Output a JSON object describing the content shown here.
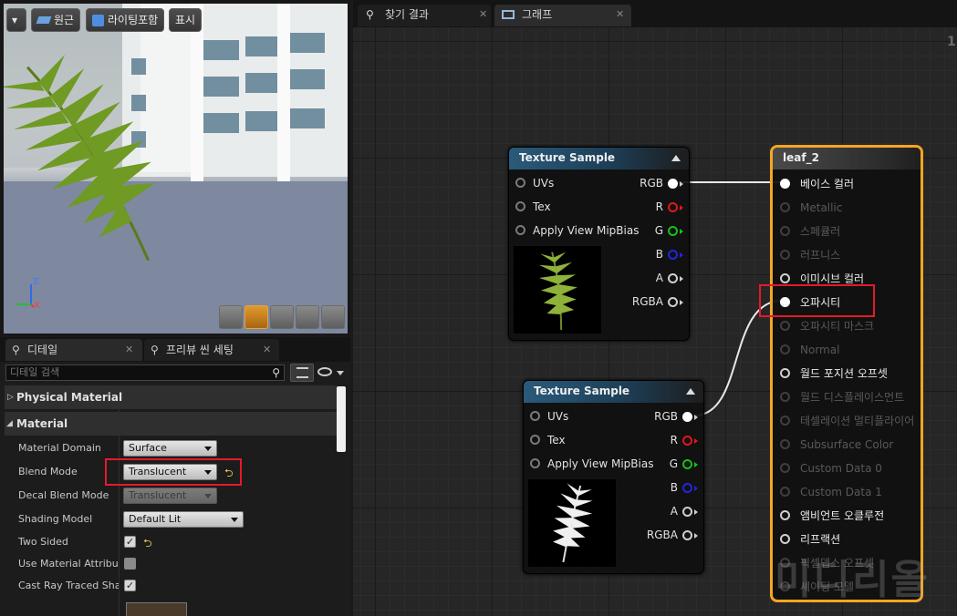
{
  "viewport": {
    "menu_label": "▾",
    "perspective_label": "원근",
    "lit_label": "라이팅포함",
    "show_label": "표시",
    "axis_z": "Z",
    "axis_x": "X"
  },
  "details": {
    "tab1": "디테일",
    "tab2": "프리뷰 씬 세팅",
    "search_placeholder": "디테일 검색",
    "section_physical": "Physical Material",
    "section_material": "Material",
    "props": [
      {
        "label": "Material Domain",
        "value": "Surface"
      },
      {
        "label": "Blend Mode",
        "value": "Translucent"
      },
      {
        "label": "Decal Blend Mode",
        "value": "Translucent"
      },
      {
        "label": "Shading Model",
        "value": "Default Lit"
      },
      {
        "label": "Two Sided",
        "value": "✓"
      },
      {
        "label": "Use Material Attribute",
        "value": ""
      },
      {
        "label": "Cast Ray Traced Shad",
        "value": "✓"
      }
    ],
    "reset_icon": "⮌"
  },
  "graph_tabs": {
    "tab1": "찾기 결과",
    "tab2": "그래프",
    "zoom": "1"
  },
  "texture_node_1": {
    "title": "Texture Sample",
    "inputs": [
      "UVs",
      "Tex",
      "Apply View MipBias"
    ],
    "outputs": [
      "RGB",
      "R",
      "G",
      "B",
      "A",
      "RGBA"
    ]
  },
  "texture_node_2": {
    "title": "Texture Sample",
    "inputs": [
      "UVs",
      "Tex",
      "Apply View MipBias"
    ],
    "outputs": [
      "RGB",
      "R",
      "G",
      "B",
      "A",
      "RGBA"
    ]
  },
  "material_node": {
    "title": "leaf_2",
    "pins": [
      {
        "label": "베이스 컬러",
        "state": "connected"
      },
      {
        "label": "Metallic",
        "state": "disabled"
      },
      {
        "label": "스페큘러",
        "state": "disabled"
      },
      {
        "label": "러프니스",
        "state": "disabled"
      },
      {
        "label": "이미시브 컬러",
        "state": "enabled"
      },
      {
        "label": "오파시티",
        "state": "connected"
      },
      {
        "label": "오파시티 마스크",
        "state": "disabled"
      },
      {
        "label": "Normal",
        "state": "disabled"
      },
      {
        "label": "월드 포지션 오프셋",
        "state": "enabled"
      },
      {
        "label": "월드 디스플레이스먼트",
        "state": "disabled"
      },
      {
        "label": "테셀레이션 멀티플라이어",
        "state": "disabled"
      },
      {
        "label": "Subsurface Color",
        "state": "disabled"
      },
      {
        "label": "Custom Data 0",
        "state": "disabled"
      },
      {
        "label": "Custom Data 1",
        "state": "disabled"
      },
      {
        "label": "앰비언트 오클루전",
        "state": "enabled"
      },
      {
        "label": "리프랙션",
        "state": "enabled"
      },
      {
        "label": "픽셀뎁스 오프셋",
        "state": "disabled"
      },
      {
        "label": "셰이딩 모델",
        "state": "disabled"
      }
    ]
  },
  "watermark": "미디리올",
  "colors": {
    "selection_outline": "#f5a623",
    "highlight_box": "#e5192b",
    "wire": "#e8e8e8"
  }
}
